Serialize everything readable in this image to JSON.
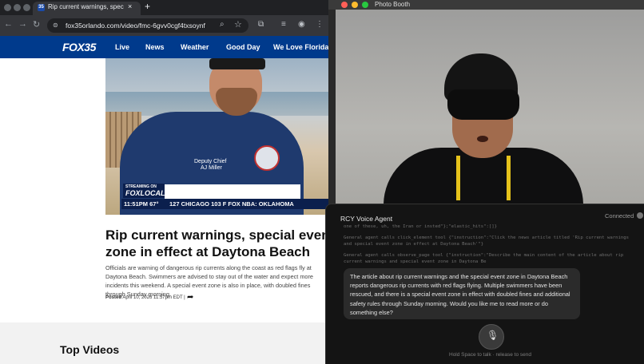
{
  "browser": {
    "tab": {
      "favicon": "35",
      "title": "Rip current warnings, special",
      "close": "×",
      "new_tab": "+"
    },
    "url": "fox35orlando.com/video/fmc-6gvv0cgf4txsoynf",
    "nav": {
      "back": "←",
      "forward": "→",
      "reload": "↻",
      "site_info": "⊜"
    },
    "icons": {
      "zoom": "⌕",
      "star": "☆",
      "ext1": "⧉",
      "ext2": "≡",
      "profile": "◉",
      "menu": "⋮"
    }
  },
  "site": {
    "logo": "FOX35",
    "nav_items": [
      "Live",
      "News",
      "Weather",
      "Good Day",
      "We Love Florida"
    ]
  },
  "video": {
    "shirt_line1": "Deputy Chief",
    "shirt_line2": "AJ Miller",
    "streaming_small": "STREAMING ON",
    "streaming_brand": "FOXLOCAL",
    "ticker_time": "11:51PM  67°",
    "ticker_text": "127   CHICAGO   103   F      FOX     NBA:  OKLAHOMA"
  },
  "article": {
    "headline": "Rip current warnings, special event zone in effect at Daytona Beach",
    "summary": "Officials are warning of dangerous rip currents along the coast as red flags fly at Daytona Beach. Swimmers are advised to stay out of the water and expect more incidents this weekend. A special event zone is also in place, with doubled fines through Sunday morning.",
    "posted_label": "Posted",
    "posted_date": "April 10, 2026 11:57pm EDT",
    "share_icon": "➦"
  },
  "section": {
    "top_videos": "Top Videos"
  },
  "photobooth": {
    "title": "Photo Booth"
  },
  "agent": {
    "title": "RCY Voice Agent",
    "status": "Connected",
    "log": [
      "one of these, uh, the Iran or insted\"};\"elastic_hits\":[]}",
      "General agent calls click_element tool {\"instruction\":\"Click the news article titled 'Rip current warnings and special event zone in effect at Daytona Beach'\"}",
      "General agent calls observe_page tool {\"instruction\":\"Describe the main content of the article about rip current warnings and special event zone in Daytona Be"
    ],
    "reply": "The article about rip current warnings and the special event zone in Daytona Beach reports dangerous rip currents with red flags flying. Multiple swimmers have been rescued, and there is a special event zone in effect with doubled fines and additional safety rules through Sunday morning. Would you like me to read more or do something else?",
    "mic_icon": "🎙",
    "hint": "Hold Space to talk · release to send"
  },
  "colors": {
    "fox_blue": "#003a8c",
    "browser_dark": "#202124",
    "agent_bg": "#141414",
    "hoodie_string": "#e5c21b"
  }
}
